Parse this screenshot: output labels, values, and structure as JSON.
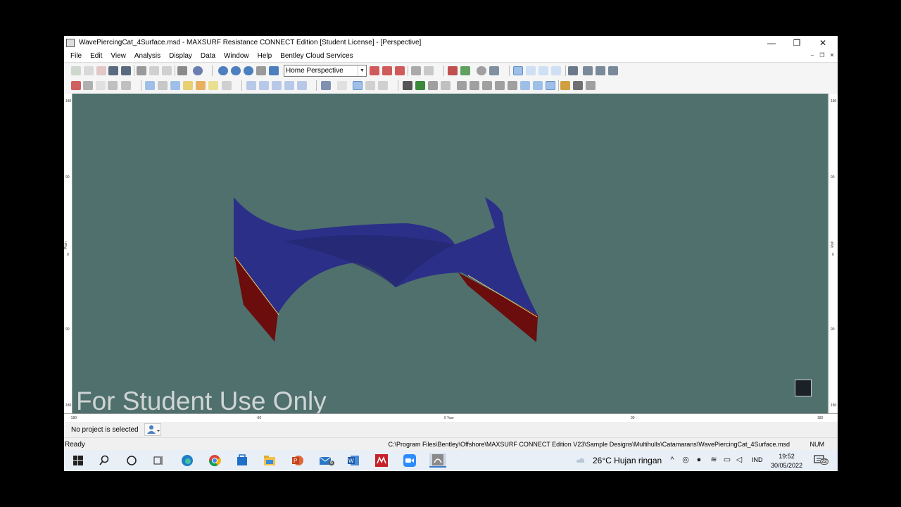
{
  "window": {
    "title": "WavePiercingCat_4Surface.msd - MAXSURF Resistance CONNECT Edition [Student License] - [Perspective]",
    "controls": {
      "minimize": "—",
      "maximize": "❐",
      "close": "✕"
    }
  },
  "menu": {
    "items": [
      "File",
      "Edit",
      "View",
      "Analysis",
      "Display",
      "Data",
      "Window",
      "Help",
      "Bentley Cloud Services"
    ],
    "mdi_controls": {
      "minimize": "‒",
      "restore": "❐",
      "close": "✕"
    }
  },
  "toolbar": {
    "view_select_value": "Home Perspective"
  },
  "viewport": {
    "background": "#4f706d",
    "hull_color": "#2b2f88",
    "keel_color": "#6b0d0d",
    "watermark": "For Student Use Only",
    "left_ruler": {
      "ticks": [
        "180",
        "90",
        "0",
        "90",
        "180"
      ],
      "caption": "Pitch"
    },
    "right_ruler": {
      "ticks": [
        "180",
        "90",
        "0",
        "90",
        "180"
      ],
      "caption": "Roll"
    },
    "bottom_ruler": {
      "ticks": [
        "-180",
        "-90",
        "0 Yaw",
        "90",
        "180"
      ]
    }
  },
  "project": {
    "label": "No project is selected"
  },
  "status": {
    "ready": "Ready",
    "path": "C:\\Program Files\\Bentley\\Offshore\\MAXSURF CONNECT Edition V23\\Sample Designs\\Multihulls\\Catamarans\\WavePiercingCat_4Surface.msd",
    "num": "NUM"
  },
  "taskbar": {
    "weather": "26°C  Hujan ringan",
    "language": "IND",
    "time": "19:52",
    "date": "30/05/2022",
    "mail_badge": "6",
    "notification_count": "22"
  }
}
